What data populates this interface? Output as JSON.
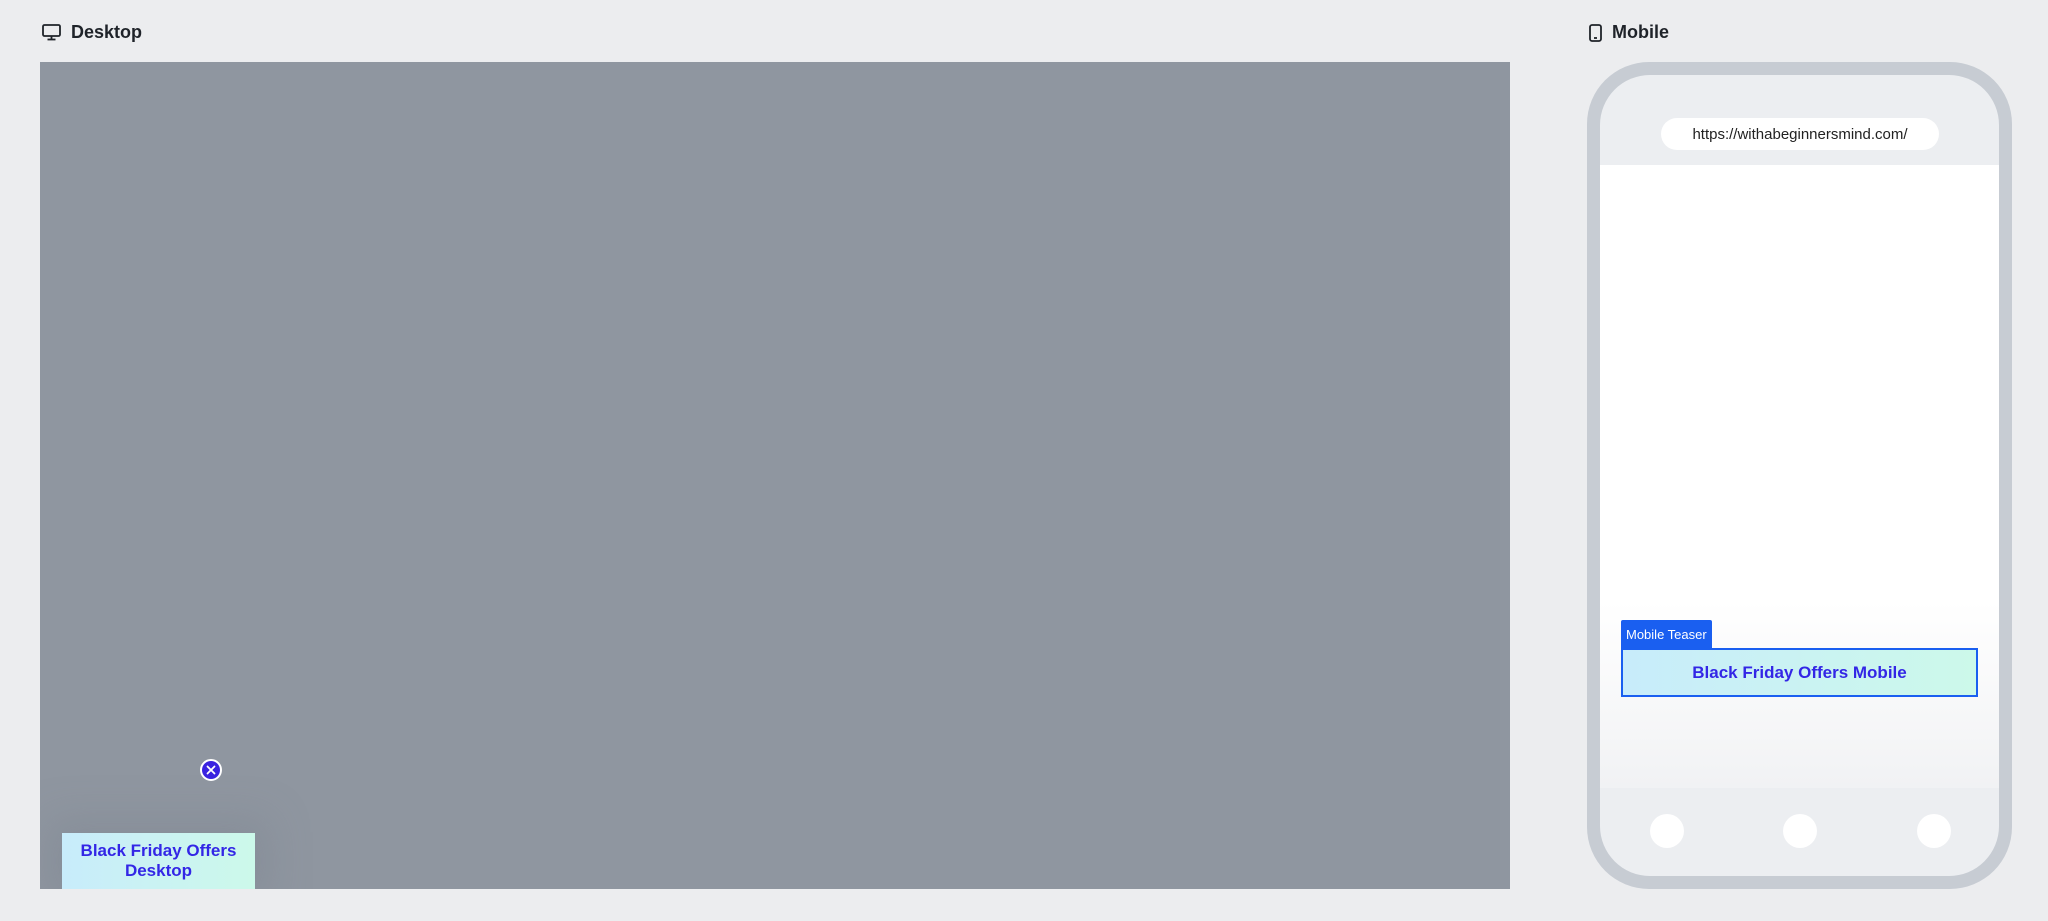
{
  "labels": {
    "desktop": "Desktop",
    "mobile": "Mobile"
  },
  "desktop_preview": {
    "teaser_text": "Black Friday Offers Desktop",
    "close_icon": "close-icon"
  },
  "mobile_preview": {
    "url": "https://withabeginnersmind.com/",
    "teaser_tag": "Mobile Teaser",
    "teaser_text": "Black Friday Offers Mobile"
  },
  "colors": {
    "page_background": "#ecedef",
    "desktop_canvas": "#8f96a0",
    "teaser_text": "#3326e6",
    "teaser_gradient_start": "#c8ecfb",
    "teaser_gradient_end": "#ccf9ea",
    "accent_blue": "#1a5ff0",
    "phone_frame": "#c7ccd3"
  },
  "icons": [
    "monitor-icon",
    "smartphone-icon",
    "close-icon"
  ]
}
